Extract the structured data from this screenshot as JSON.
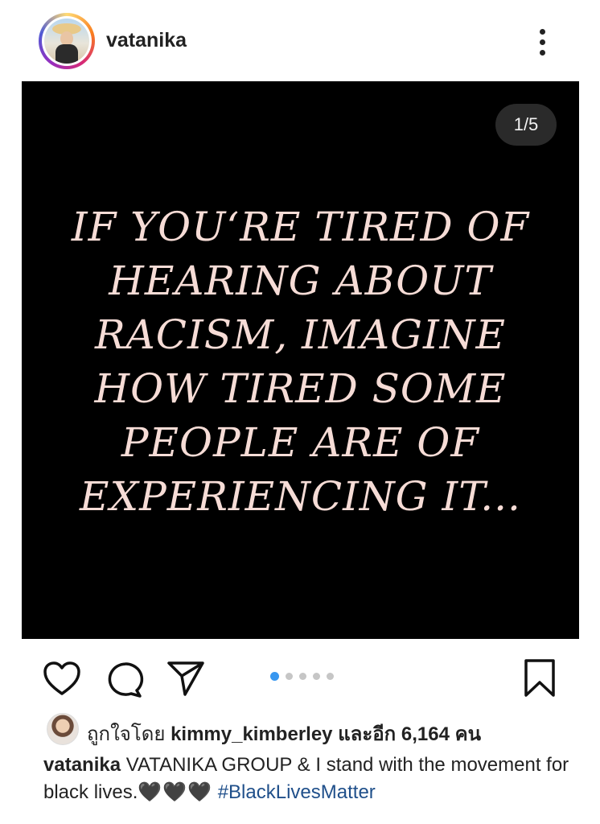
{
  "post": {
    "username": "vatanika",
    "counter": "1/5",
    "quote_lines": [
      "IF YOU‘RE TIRED OF",
      "HEARING ABOUT",
      "RACISM, IMAGINE",
      "HOW TIRED SOME",
      "PEOPLE ARE OF",
      "EXPERIENCING IT..."
    ],
    "carousel": {
      "count": 5,
      "active_index": 0
    }
  },
  "likes": {
    "prefix": "ถูกใจโดย",
    "liker": "kimmy_kimberley",
    "middle": "และอีก",
    "count": "6,164",
    "suffix": "คน"
  },
  "caption": {
    "username": "vatanika",
    "text": "VATANIKA GROUP & I stand with the movement for black lives.",
    "emoji": "🖤🖤🖤",
    "hashtag": "#BlackLivesMatter"
  },
  "icons": {
    "more": "more-vertical-icon",
    "like": "heart-icon",
    "comment": "comment-icon",
    "share": "paper-plane-icon",
    "save": "bookmark-icon"
  }
}
